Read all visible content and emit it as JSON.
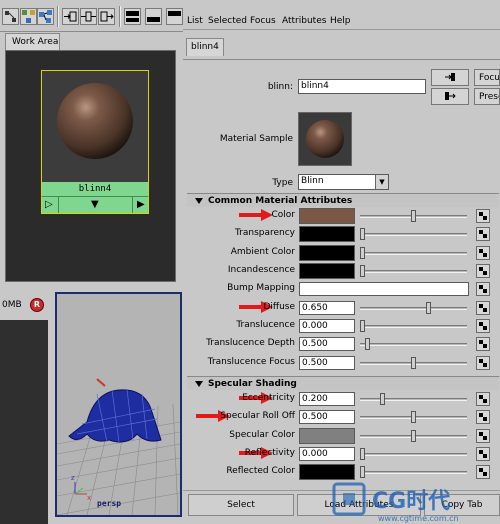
{
  "menu": {
    "items": [
      "List",
      "Selected",
      "Focus",
      "Attributes",
      "Help"
    ]
  },
  "panels": {
    "work_area_tab": "Work Area",
    "outliner_header": "0MB"
  },
  "hypershade": {
    "node_name": "blinn4"
  },
  "viewport": {
    "label": "persp"
  },
  "attribute_editor": {
    "tab": "blinn4",
    "node_label": "blinn:",
    "node_value": "blinn4",
    "side_buttons": [
      "Focus",
      "Presets"
    ],
    "material_sample_label": "Material Sample",
    "type_label": "Type",
    "type_value": "Blinn",
    "sections": {
      "common": "Common Material Attributes",
      "specular": "Specular Shading"
    },
    "common_attrs": [
      {
        "label": "Color",
        "kind": "color",
        "value": "",
        "color": "#7b5846",
        "slider": 0.5,
        "arrow": true
      },
      {
        "label": "Transparency",
        "kind": "color",
        "value": "",
        "color": "#000000",
        "slider": 0.0,
        "arrow": false
      },
      {
        "label": "Ambient Color",
        "kind": "color",
        "value": "",
        "color": "#000000",
        "slider": 0.0,
        "arrow": false
      },
      {
        "label": "Incandescence",
        "kind": "color",
        "value": "",
        "color": "#000000",
        "slider": 0.0,
        "arrow": false
      },
      {
        "label": "Bump Mapping",
        "kind": "bump",
        "value": "",
        "color": "",
        "slider": null,
        "arrow": false
      },
      {
        "label": "Diffuse",
        "kind": "number",
        "value": "0.650",
        "color": "",
        "slider": 0.65,
        "arrow": true
      },
      {
        "label": "Translucence",
        "kind": "number",
        "value": "0.000",
        "color": "",
        "slider": 0.0,
        "arrow": false
      },
      {
        "label": "Translucence Depth",
        "kind": "number",
        "value": "0.500",
        "color": "",
        "slider": 0.05,
        "arrow": false
      },
      {
        "label": "Translucence Focus",
        "kind": "number",
        "value": "0.500",
        "color": "",
        "slider": 0.5,
        "arrow": false
      }
    ],
    "specular_attrs": [
      {
        "label": "Eccentricity",
        "kind": "number",
        "value": "0.200",
        "color": "",
        "slider": 0.2,
        "arrow": true
      },
      {
        "label": "Specular Roll Off",
        "kind": "number",
        "value": "0.500",
        "color": "",
        "slider": 0.5,
        "arrow": true
      },
      {
        "label": "Specular Color",
        "kind": "color",
        "value": "",
        "color": "#808080",
        "slider": 0.5,
        "arrow": false
      },
      {
        "label": "Reflectivity",
        "kind": "number",
        "value": "0.000",
        "color": "",
        "slider": 0.0,
        "arrow": true
      },
      {
        "label": "Reflected Color",
        "kind": "color",
        "value": "",
        "color": "#000000",
        "slider": 0.0,
        "arrow": false
      }
    ],
    "bottom_buttons": [
      "Select",
      "Load Attributes",
      "Copy Tab"
    ]
  },
  "watermark": {
    "brand": "CG时代",
    "url": "www.cgtime.com.cn"
  },
  "colors": {
    "node_green": "#7fd68f",
    "node_border": "#d8d800",
    "arrow_red": "#e11b1b",
    "viewport_border": "#1d2c6e"
  }
}
